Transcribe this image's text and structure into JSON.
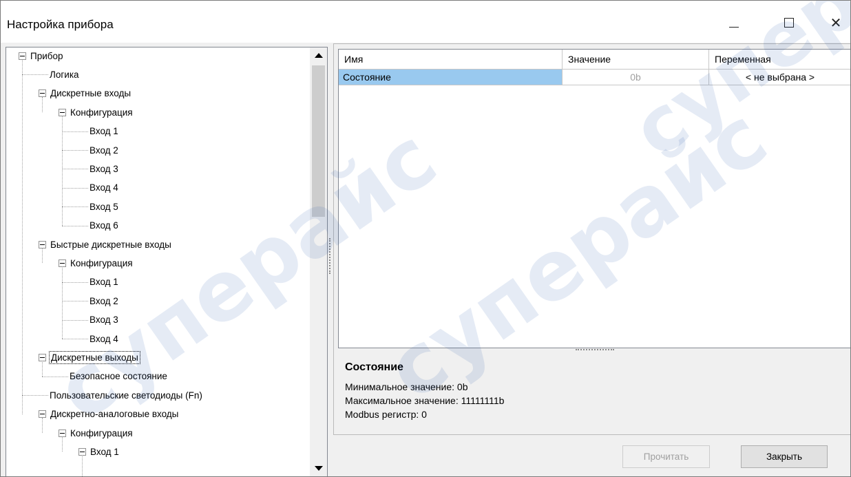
{
  "window": {
    "title": "Настройка прибора",
    "minimize_icon": "minimize-icon",
    "maximize_icon": "maximize-icon",
    "close_glyph": "✕"
  },
  "tree": {
    "nodes": [
      {
        "label": "Прибор",
        "level": 0,
        "expander": true
      },
      {
        "label": "Логика",
        "level": 1,
        "expander": false
      },
      {
        "label": "Дискретные входы",
        "level": 1,
        "expander": true
      },
      {
        "label": "Конфигурация",
        "level": 2,
        "expander": true
      },
      {
        "label": "Вход 1",
        "level": 3,
        "expander": false
      },
      {
        "label": "Вход 2",
        "level": 3,
        "expander": false
      },
      {
        "label": "Вход 3",
        "level": 3,
        "expander": false
      },
      {
        "label": "Вход 4",
        "level": 3,
        "expander": false
      },
      {
        "label": "Вход 5",
        "level": 3,
        "expander": false
      },
      {
        "label": "Вход 6",
        "level": 3,
        "expander": false
      },
      {
        "label": "Быстрые дискретные входы",
        "level": 1,
        "expander": true
      },
      {
        "label": "Конфигурация",
        "level": 2,
        "expander": true
      },
      {
        "label": "Вход 1",
        "level": 3,
        "expander": false
      },
      {
        "label": "Вход 2",
        "level": 3,
        "expander": false
      },
      {
        "label": "Вход 3",
        "level": 3,
        "expander": false
      },
      {
        "label": "Вход 4",
        "level": 3,
        "expander": false
      },
      {
        "label": "Дискретные выходы",
        "level": 1,
        "expander": true,
        "selected": true
      },
      {
        "label": "Безопасное состояние",
        "level": 2,
        "expander": false
      },
      {
        "label": "Пользовательские светодиоды (Fn)",
        "level": 1,
        "expander": false
      },
      {
        "label": "Дискретно-аналоговые входы",
        "level": 1,
        "expander": true
      },
      {
        "label": "Конфигурация",
        "level": 2,
        "expander": true
      },
      {
        "label": "Вход 1",
        "level": 3,
        "expander": true
      }
    ]
  },
  "grid": {
    "columns": [
      "Имя",
      "Значение",
      "Переменная"
    ],
    "rows": [
      {
        "name": "Состояние",
        "value": "0b",
        "variable": "< не выбрана >"
      }
    ]
  },
  "description": {
    "title": "Состояние",
    "lines": [
      "Минимальное значение: 0b",
      "Максимальное значение: 11111111b",
      "Modbus регистр: 0"
    ]
  },
  "buttons": {
    "read": "Прочитать",
    "close": "Закрыть"
  },
  "watermark": {
    "text": "суперайс"
  }
}
